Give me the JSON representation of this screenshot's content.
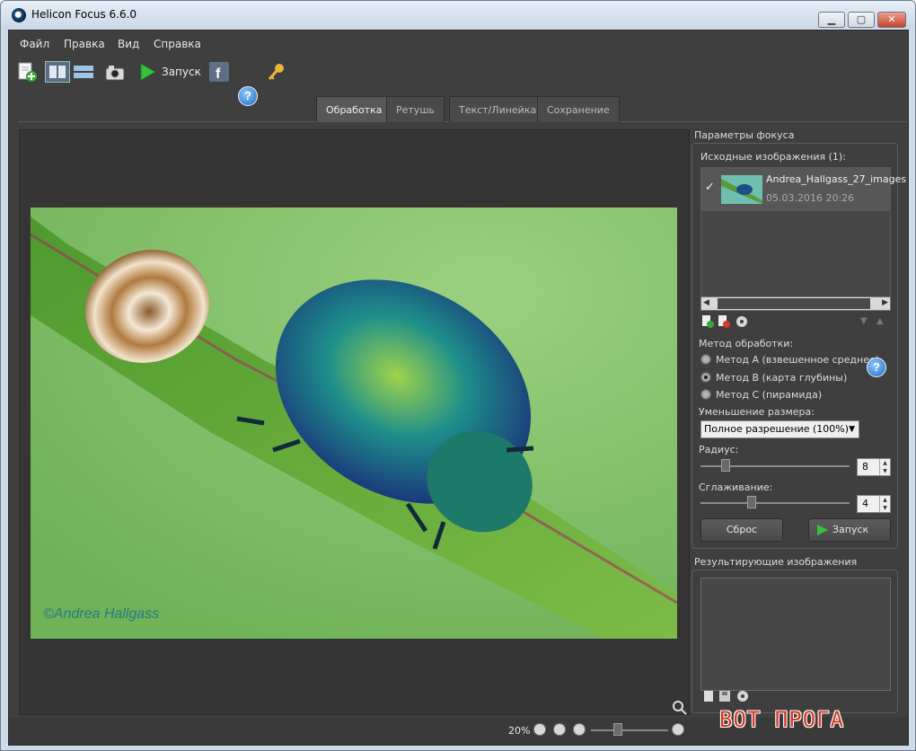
{
  "window": {
    "title": "Helicon Focus 6.6.0",
    "minimize": "▁",
    "maximize": "▢",
    "close": "✕"
  },
  "menu": [
    "Файл",
    "Правка",
    "Вид",
    "Справка"
  ],
  "toolbar": {
    "run_label": "Запуск"
  },
  "tabs": [
    {
      "label": "Обработка",
      "active": true
    },
    {
      "label": "Ретушь",
      "active": false
    },
    {
      "label": "Текст/Линейка",
      "active": false
    },
    {
      "label": "Сохранение",
      "active": false
    }
  ],
  "image": {
    "credit": "©Andrea Hallgass"
  },
  "status": {
    "zoom": "20%"
  },
  "focus_params": {
    "title": "Параметры фокуса",
    "source_label": "Исходные изображения (1):",
    "files": [
      {
        "name": "Andrea_Hallgass_27_images",
        "date": "05.03.2016 20:26",
        "checked": true
      }
    ],
    "method_label": "Метод обработки:",
    "methods": [
      {
        "label": "Метод A (взвешенное среднее)",
        "selected": false
      },
      {
        "label": "Метод B (карта глубины)",
        "selected": true
      },
      {
        "label": "Метод C (пирамида)",
        "selected": false
      }
    ],
    "downsize_label": "Уменьшение размера:",
    "downsize_value": "Полное разрешение (100%)",
    "radius_label": "Радиус:",
    "radius_value": "8",
    "smoothing_label": "Сглаживание:",
    "smoothing_value": "4",
    "reset_label": "Сброс",
    "run_label": "Запуск"
  },
  "results": {
    "title": "Результирующие изображения"
  },
  "site_watermark": "ВОТ ПРОГА",
  "colors": {
    "accent_green": "#36c23a",
    "help_blue": "#1f6cc4",
    "panel_bg": "#3f3f3f"
  }
}
